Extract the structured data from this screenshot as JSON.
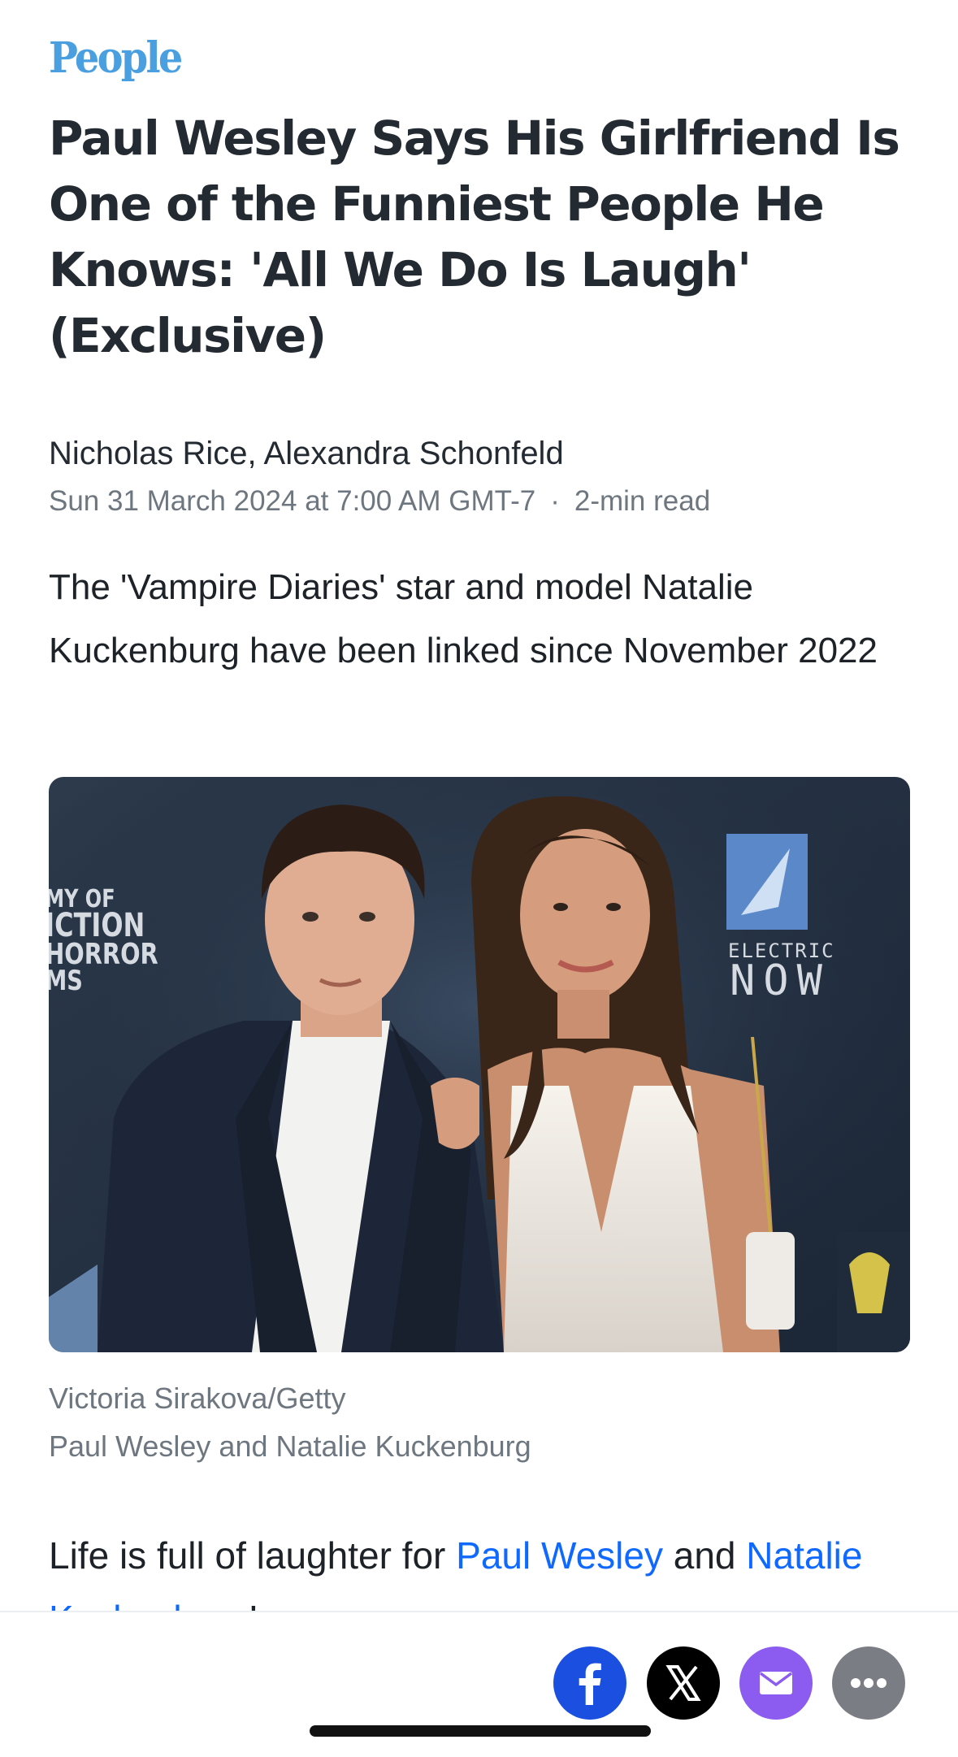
{
  "brand": {
    "logo_text": "People",
    "logo_color": "#4a9fe0"
  },
  "article": {
    "headline": "Paul Wesley Says His Girlfriend Is One of the Funniest People He Knows: 'All We Do Is Laugh' (Exclusive)",
    "authors": "Nicholas Rice, Alexandra Schonfeld",
    "date": "Sun 31 March 2024 at 7:00 AM GMT-7",
    "separator": "·",
    "read_time": "2-min read",
    "summary": "The 'Vampire Diaries' star and model Natalie Kuckenburg have been linked since November 2022",
    "image": {
      "credit": "Victoria Sirakova/Getty",
      "caption": "Paul Wesley and Natalie Kuckenburg",
      "backdrop_text_left": "MY OF\nICTION\nHORROR\nMS",
      "backdrop_text_right_top": "ELECTRIC",
      "backdrop_text_right_bottom": "NOW"
    },
    "body": {
      "prefix": "Life is full of laughter for ",
      "link1": "Paul Wesley",
      "middle": " and ",
      "link2": "Natalie Kuckenburg",
      "suffix": "!"
    },
    "link_color": "#0f69ff"
  },
  "share_bar": {
    "buttons": [
      {
        "name": "facebook",
        "icon": "facebook-icon",
        "color": "#1a4fe0"
      },
      {
        "name": "x",
        "icon": "x-icon",
        "color": "#000000"
      },
      {
        "name": "email",
        "icon": "mail-icon",
        "color": "#8c5cf0"
      },
      {
        "name": "more",
        "icon": "more-icon",
        "color": "#7a7e84"
      }
    ]
  }
}
